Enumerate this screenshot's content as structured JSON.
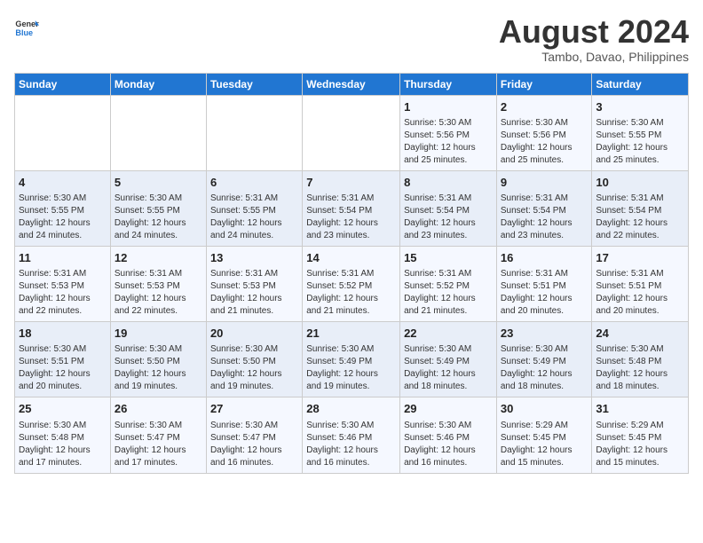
{
  "header": {
    "logo_line1": "General",
    "logo_line2": "Blue",
    "month_year": "August 2024",
    "location": "Tambo, Davao, Philippines"
  },
  "weekdays": [
    "Sunday",
    "Monday",
    "Tuesday",
    "Wednesday",
    "Thursday",
    "Friday",
    "Saturday"
  ],
  "weeks": [
    [
      {
        "day": "",
        "detail": ""
      },
      {
        "day": "",
        "detail": ""
      },
      {
        "day": "",
        "detail": ""
      },
      {
        "day": "",
        "detail": ""
      },
      {
        "day": "1",
        "detail": "Sunrise: 5:30 AM\nSunset: 5:56 PM\nDaylight: 12 hours\nand 25 minutes."
      },
      {
        "day": "2",
        "detail": "Sunrise: 5:30 AM\nSunset: 5:56 PM\nDaylight: 12 hours\nand 25 minutes."
      },
      {
        "day": "3",
        "detail": "Sunrise: 5:30 AM\nSunset: 5:55 PM\nDaylight: 12 hours\nand 25 minutes."
      }
    ],
    [
      {
        "day": "4",
        "detail": "Sunrise: 5:30 AM\nSunset: 5:55 PM\nDaylight: 12 hours\nand 24 minutes."
      },
      {
        "day": "5",
        "detail": "Sunrise: 5:30 AM\nSunset: 5:55 PM\nDaylight: 12 hours\nand 24 minutes."
      },
      {
        "day": "6",
        "detail": "Sunrise: 5:31 AM\nSunset: 5:55 PM\nDaylight: 12 hours\nand 24 minutes."
      },
      {
        "day": "7",
        "detail": "Sunrise: 5:31 AM\nSunset: 5:54 PM\nDaylight: 12 hours\nand 23 minutes."
      },
      {
        "day": "8",
        "detail": "Sunrise: 5:31 AM\nSunset: 5:54 PM\nDaylight: 12 hours\nand 23 minutes."
      },
      {
        "day": "9",
        "detail": "Sunrise: 5:31 AM\nSunset: 5:54 PM\nDaylight: 12 hours\nand 23 minutes."
      },
      {
        "day": "10",
        "detail": "Sunrise: 5:31 AM\nSunset: 5:54 PM\nDaylight: 12 hours\nand 22 minutes."
      }
    ],
    [
      {
        "day": "11",
        "detail": "Sunrise: 5:31 AM\nSunset: 5:53 PM\nDaylight: 12 hours\nand 22 minutes."
      },
      {
        "day": "12",
        "detail": "Sunrise: 5:31 AM\nSunset: 5:53 PM\nDaylight: 12 hours\nand 22 minutes."
      },
      {
        "day": "13",
        "detail": "Sunrise: 5:31 AM\nSunset: 5:53 PM\nDaylight: 12 hours\nand 21 minutes."
      },
      {
        "day": "14",
        "detail": "Sunrise: 5:31 AM\nSunset: 5:52 PM\nDaylight: 12 hours\nand 21 minutes."
      },
      {
        "day": "15",
        "detail": "Sunrise: 5:31 AM\nSunset: 5:52 PM\nDaylight: 12 hours\nand 21 minutes."
      },
      {
        "day": "16",
        "detail": "Sunrise: 5:31 AM\nSunset: 5:51 PM\nDaylight: 12 hours\nand 20 minutes."
      },
      {
        "day": "17",
        "detail": "Sunrise: 5:31 AM\nSunset: 5:51 PM\nDaylight: 12 hours\nand 20 minutes."
      }
    ],
    [
      {
        "day": "18",
        "detail": "Sunrise: 5:30 AM\nSunset: 5:51 PM\nDaylight: 12 hours\nand 20 minutes."
      },
      {
        "day": "19",
        "detail": "Sunrise: 5:30 AM\nSunset: 5:50 PM\nDaylight: 12 hours\nand 19 minutes."
      },
      {
        "day": "20",
        "detail": "Sunrise: 5:30 AM\nSunset: 5:50 PM\nDaylight: 12 hours\nand 19 minutes."
      },
      {
        "day": "21",
        "detail": "Sunrise: 5:30 AM\nSunset: 5:49 PM\nDaylight: 12 hours\nand 19 minutes."
      },
      {
        "day": "22",
        "detail": "Sunrise: 5:30 AM\nSunset: 5:49 PM\nDaylight: 12 hours\nand 18 minutes."
      },
      {
        "day": "23",
        "detail": "Sunrise: 5:30 AM\nSunset: 5:49 PM\nDaylight: 12 hours\nand 18 minutes."
      },
      {
        "day": "24",
        "detail": "Sunrise: 5:30 AM\nSunset: 5:48 PM\nDaylight: 12 hours\nand 18 minutes."
      }
    ],
    [
      {
        "day": "25",
        "detail": "Sunrise: 5:30 AM\nSunset: 5:48 PM\nDaylight: 12 hours\nand 17 minutes."
      },
      {
        "day": "26",
        "detail": "Sunrise: 5:30 AM\nSunset: 5:47 PM\nDaylight: 12 hours\nand 17 minutes."
      },
      {
        "day": "27",
        "detail": "Sunrise: 5:30 AM\nSunset: 5:47 PM\nDaylight: 12 hours\nand 16 minutes."
      },
      {
        "day": "28",
        "detail": "Sunrise: 5:30 AM\nSunset: 5:46 PM\nDaylight: 12 hours\nand 16 minutes."
      },
      {
        "day": "29",
        "detail": "Sunrise: 5:30 AM\nSunset: 5:46 PM\nDaylight: 12 hours\nand 16 minutes."
      },
      {
        "day": "30",
        "detail": "Sunrise: 5:29 AM\nSunset: 5:45 PM\nDaylight: 12 hours\nand 15 minutes."
      },
      {
        "day": "31",
        "detail": "Sunrise: 5:29 AM\nSunset: 5:45 PM\nDaylight: 12 hours\nand 15 minutes."
      }
    ]
  ]
}
